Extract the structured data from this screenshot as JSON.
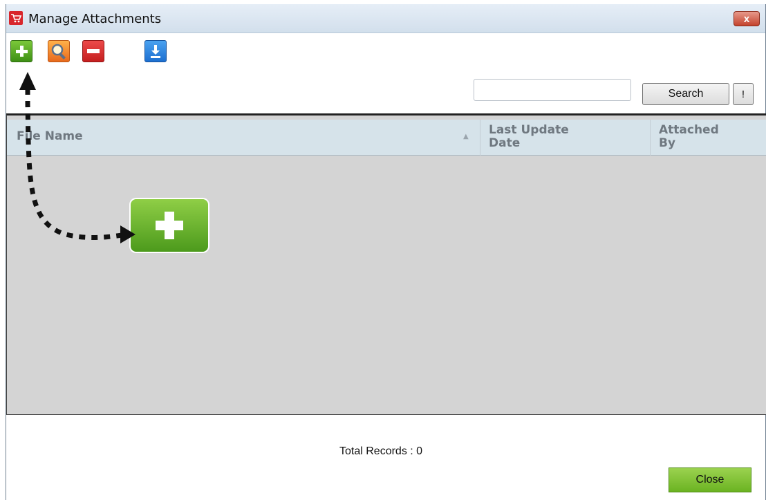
{
  "window": {
    "title": "Manage Attachments",
    "close_glyph": "x"
  },
  "toolbar": {
    "add_icon": "plus-icon",
    "search_icon": "magnifier-icon",
    "remove_icon": "minus-icon",
    "download_icon": "download-icon"
  },
  "search": {
    "value": "",
    "placeholder": "",
    "button_label": "Search",
    "clear_label": "!"
  },
  "grid": {
    "columns": [
      "File Name",
      "Last Update Date",
      "Attached By"
    ],
    "rows": []
  },
  "footer": {
    "total_records": "Total Records : 0",
    "close_label": "Close"
  },
  "colors": {
    "add_green": "#5aa823",
    "search_orange": "#f08a2c",
    "remove_red": "#d93434",
    "download_blue": "#2f86e0",
    "close_green": "#7fc136"
  }
}
